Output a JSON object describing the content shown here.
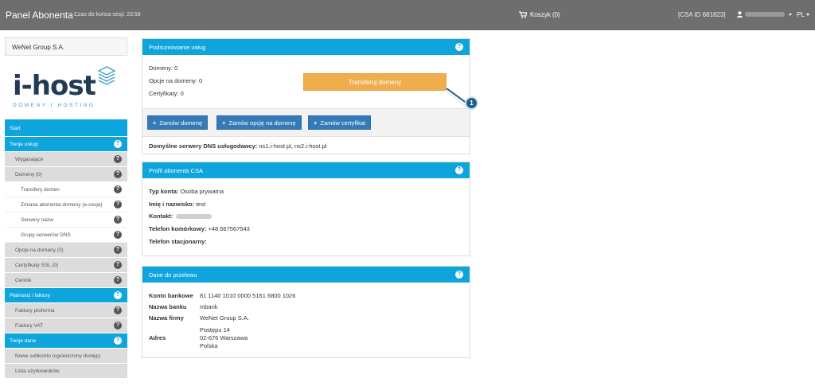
{
  "topbar": {
    "brand": "Panel Abonenta",
    "session": "Czas do końca sesji: 23:58",
    "cart": "Koszyk (0)",
    "csa_id": "[CSA ID 681823]",
    "lang": "PL"
  },
  "sidebar": {
    "company": "WeNet Group S.A.",
    "logo_text": "i-host",
    "logo_tagline": "DOMENY I HOSTING",
    "items": [
      {
        "label": "Start"
      },
      {
        "label": "Twoje usługi"
      },
      {
        "label": "Wygasające"
      },
      {
        "label": "Domeny (0)"
      },
      {
        "label": "Transfery domen"
      },
      {
        "label": "Zmiana abonenta domeny (e-cesja)"
      },
      {
        "label": "Serwery nazw"
      },
      {
        "label": "Grupy serwerów DNS"
      },
      {
        "label": "Opcje na domeny (0)"
      },
      {
        "label": "Certyfikaty SSL (0)"
      },
      {
        "label": "Cennik"
      },
      {
        "label": "Płatności i faktury"
      },
      {
        "label": "Faktury proforma"
      },
      {
        "label": "Faktury VAT"
      },
      {
        "label": "Twoje dane"
      },
      {
        "label": "Nowe subkonto (ograniczony dostęp)"
      },
      {
        "label": "Lista użytkowników"
      }
    ]
  },
  "summary": {
    "title": "Podsumowanie usług",
    "domains": "Domeny: 0",
    "options": "Opcje na domeny: 0",
    "certs": "Certyfikaty: 0",
    "transfer_button": "Transferuj domeny",
    "callout_number": "1",
    "order_domain": "Zamów domenę",
    "order_option": "Zamów opcję na domenę",
    "order_cert": "Zamów certyfikat",
    "dns_label": "Domyślne serwery DNS usługodawcy:",
    "dns_value": " ns1.i-host.pl, ns2.i-host.pl"
  },
  "profile": {
    "title": "Profil abonenta CSA",
    "account_type_label": "Typ konta:",
    "account_type_value": " Osoba prywatna",
    "name_label": "Imię i nazwisko:",
    "name_value": " test",
    "contact_label": "Kontakt:",
    "mobile_label": "Telefon komórkowy:",
    "mobile_value": " +48.567567543",
    "landline_label": "Telefon stacjonarny:"
  },
  "transfer": {
    "title": "Dane do przelewu",
    "account_label": "Konto bankowe",
    "account_value": "81 1140 1010 0000 5161 6800 1026",
    "bank_label": "Nazwa banku",
    "bank_value": "mbank",
    "company_label": "Nazwa firmy",
    "company_value": "WeNet Group S.A.",
    "address_label": "Adres",
    "address_line1": "Postępu 14",
    "address_line2": "02-676 Warszawa",
    "address_line3": "Polska"
  }
}
